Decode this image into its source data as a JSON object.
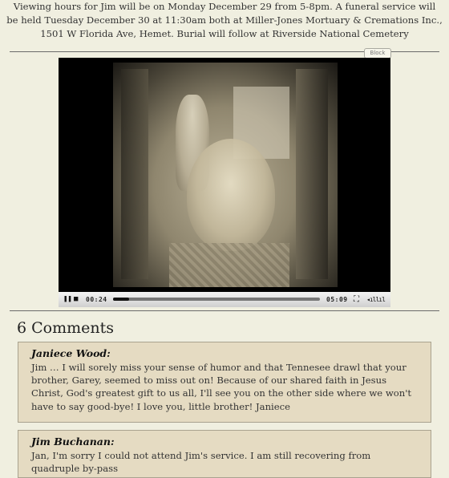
{
  "intro": {
    "text": "Viewing hours for Jim will be on Monday December 29 from 5-8pm. A funeral service will be held Tuesday December 30 at 11:30am both at Miller-Jones Mortuary & Cremations Inc., 1501 W Florida Ave, Hemet. Burial will follow at Riverside National Cemetery"
  },
  "block_label": "Block",
  "player": {
    "current_time": "00:24",
    "duration": "05:09",
    "progress": 0.078,
    "pause_icon": "pause-icon",
    "stop_icon": "stop-icon",
    "fullscreen_icon": "fullscreen-icon",
    "volume_icon": "volume-icon"
  },
  "comments": {
    "title": "6 Comments",
    "items": [
      {
        "author": "Janiece Wood:",
        "text": "Jim … I will sorely miss your sense of humor and that Tennesee drawl that your brother, Garey, seemed to miss out on! Because of our shared faith in Jesus Christ, God's greatest gift to us all, I'll see you on the other side where we won't have to say good-bye! I love you, little brother! Janiece"
      },
      {
        "author": "Jim Buchanan:",
        "text": "Jan, I'm sorry I could not attend Jim's service. I am still recovering from quadruple by-pass"
      }
    ]
  },
  "colors": {
    "page_bg": "#f0efe0",
    "comment_bg": "#e5dbc2",
    "comment_border": "#a9a28f"
  }
}
